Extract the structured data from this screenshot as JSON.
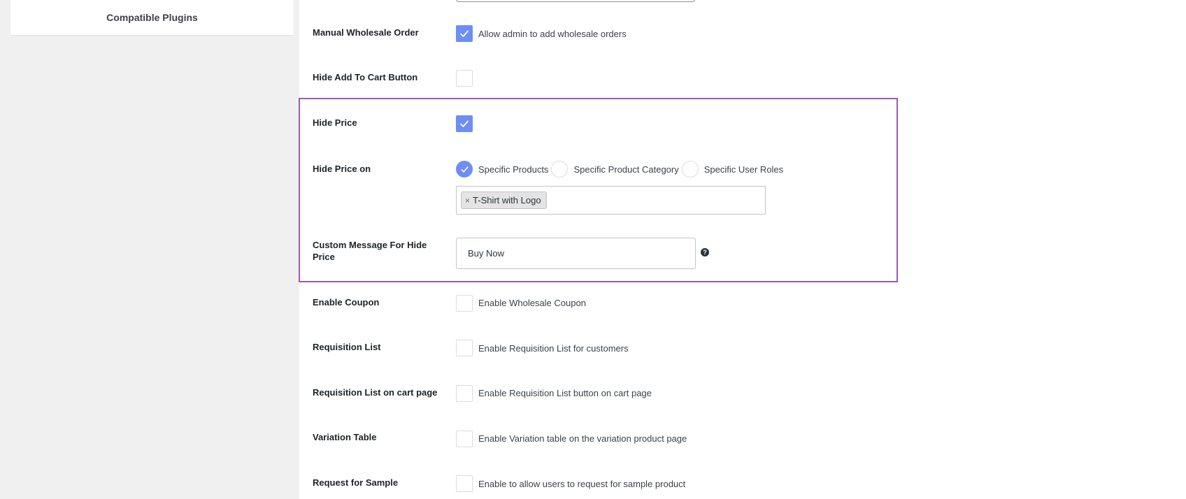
{
  "sidebar": {
    "compatible_plugins_label": "Compatible Plugins"
  },
  "settings": {
    "manual_wholesale_order": {
      "label": "Manual Wholesale Order",
      "option_text": "Allow admin to add wholesale orders",
      "checked": true
    },
    "hide_add_to_cart": {
      "label": "Hide Add To Cart Button",
      "checked": false
    },
    "hide_price": {
      "label": "Hide Price",
      "checked": true
    },
    "hide_price_on": {
      "label": "Hide Price on",
      "options": [
        {
          "label": "Specific Products",
          "selected": true
        },
        {
          "label": "Specific Product Category",
          "selected": false
        },
        {
          "label": "Specific User Roles",
          "selected": false
        }
      ],
      "selected_items": [
        "T-Shirt with Logo"
      ]
    },
    "custom_message": {
      "label": "Custom Message For Hide Price",
      "value": "Buy Now"
    },
    "enable_coupon": {
      "label": "Enable Coupon",
      "option_text": "Enable Wholesale Coupon",
      "checked": false
    },
    "requisition_list": {
      "label": "Requisition List",
      "option_text": "Enable Requisition List for customers",
      "checked": false
    },
    "requisition_list_cart": {
      "label": "Requisition List on cart page",
      "option_text": "Enable Requisition List button on cart page",
      "checked": false
    },
    "variation_table": {
      "label": "Variation Table",
      "option_text": "Enable Variation table on the variation product page",
      "checked": false
    },
    "request_sample": {
      "label": "Request for Sample",
      "option_text": "Enable to allow users to request for sample product",
      "checked": false
    }
  },
  "colors": {
    "checkbox_checked": "#6c8ef5",
    "highlight_border": "#9b59b6",
    "panel_bg": "#ffffff",
    "page_bg": "#f0f0f1"
  },
  "icons": {
    "checkmark": "check-icon",
    "help": "question-circle-icon",
    "chip_remove": "close-icon"
  }
}
